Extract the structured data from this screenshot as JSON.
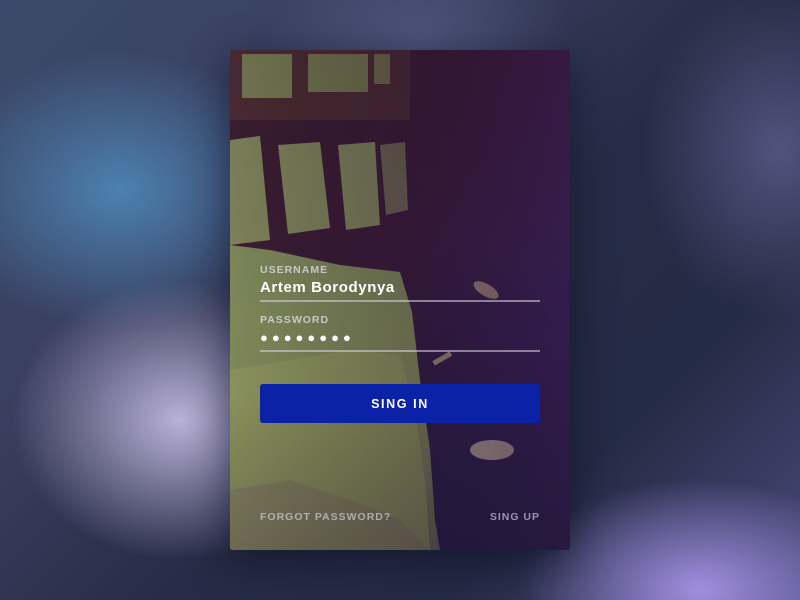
{
  "login_form": {
    "username_label": "USERNAME",
    "username_value": "Artem Borodynya",
    "password_label": "PASSWORD",
    "password_value": "●●●●●●●●",
    "signin_label": "SING IN",
    "forgot_label": "FORGOT PASSWORD?",
    "signup_label": "SING UP"
  },
  "colors": {
    "button": "#0b22a6",
    "text": "#ffffff"
  }
}
